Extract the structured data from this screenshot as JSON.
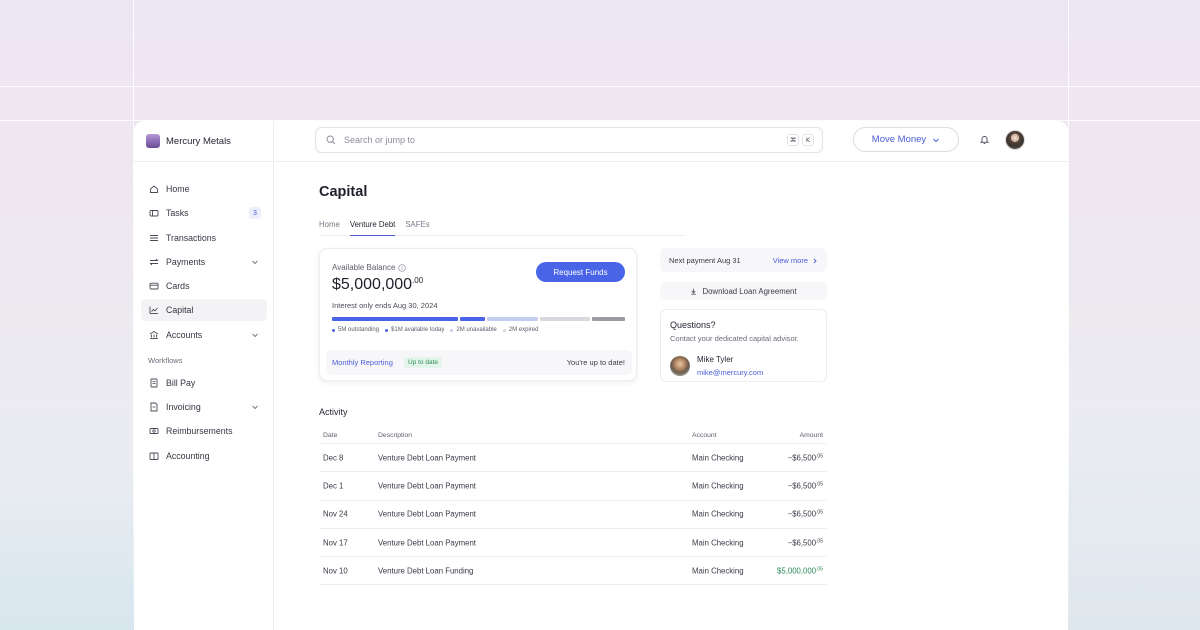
{
  "brand": {
    "name": "Mercury Metals"
  },
  "sidebar": {
    "items": [
      {
        "label": "Home",
        "icon": "home-icon"
      },
      {
        "label": "Tasks",
        "icon": "tasks-icon",
        "badge": "3"
      },
      {
        "label": "Transactions",
        "icon": "list-icon"
      },
      {
        "label": "Payments",
        "icon": "transfer-icon",
        "expandable": true
      },
      {
        "label": "Cards",
        "icon": "card-icon"
      },
      {
        "label": "Capital",
        "icon": "chart-icon",
        "active": true
      },
      {
        "label": "Accounts",
        "icon": "bank-icon",
        "expandable": true
      }
    ],
    "workflows_label": "Workflows",
    "workflow_items": [
      {
        "label": "Bill Pay",
        "icon": "bill-icon"
      },
      {
        "label": "Invoicing",
        "icon": "invoice-icon",
        "expandable": true
      },
      {
        "label": "Reimbursements",
        "icon": "cash-icon"
      },
      {
        "label": "Accounting",
        "icon": "book-icon"
      }
    ]
  },
  "topbar": {
    "search_placeholder": "Search or jump to",
    "shortcut_keys": [
      "⌘",
      "K"
    ],
    "move_money_label": "Move Money"
  },
  "page": {
    "title": "Capital",
    "tabs": [
      {
        "label": "Home",
        "active": false
      },
      {
        "label": "Venture Debt",
        "active": true
      },
      {
        "label": "SAFEs",
        "active": false
      }
    ]
  },
  "balance": {
    "label": "Available Balance",
    "amount_main": "$5,000,000",
    "amount_cents": ".00",
    "request_label": "Request Funds",
    "interest_text": "Interest only ends Aug 30, 2024",
    "progress": [
      {
        "label": "5M outstanding",
        "value": 5,
        "color": "#4a64e8"
      },
      {
        "label": "$1M available today",
        "value": 1,
        "color": "#4a64e8"
      },
      {
        "label": "2M unavailable",
        "value": 2,
        "color": "#c4ccf2"
      },
      {
        "label": "2M expired",
        "value": 2,
        "color": "#d8d8de"
      },
      {
        "value": 1.3,
        "color": "#9b9ba6"
      }
    ],
    "reporting_link": "Monthly Reporting",
    "reporting_badge": "Up to date",
    "reporting_status": "You're up to date!"
  },
  "side_panel": {
    "next_payment": "Next payment Aug 31",
    "view_more": "View more",
    "download_label": "Download Loan Agreement",
    "questions_title": "Questions?",
    "questions_sub": "Contact your dedicated capital advisor.",
    "advisor_name": "Mike Tyler",
    "advisor_email": "mike@mercury.com"
  },
  "activity": {
    "title": "Activity",
    "columns": {
      "date": "Date",
      "description": "Description",
      "account": "Account",
      "amount": "Amount"
    },
    "rows": [
      {
        "date": "Dec 8",
        "description": "Venture Debt Loan Payment",
        "account": "Main Checking",
        "amount": "−$6,500",
        "cents": ".05",
        "positive": false
      },
      {
        "date": "Dec 1",
        "description": "Venture Debt Loan Payment",
        "account": "Main Checking",
        "amount": "−$6,500",
        "cents": ".05",
        "positive": false
      },
      {
        "date": "Nov 24",
        "description": "Venture Debt Loan Payment",
        "account": "Main Checking",
        "amount": "−$6,500",
        "cents": ".05",
        "positive": false
      },
      {
        "date": "Nov 17",
        "description": "Venture Debt Loan Payment",
        "account": "Main Checking",
        "amount": "−$6,500",
        "cents": ".05",
        "positive": false
      },
      {
        "date": "Nov 10",
        "description": "Venture Debt Loan Funding",
        "account": "Main Checking",
        "amount": "$5,000,000",
        "cents": ".05",
        "positive": true
      }
    ]
  },
  "colors": {
    "accent": "#4a64e8",
    "positive": "#2b8a55"
  }
}
